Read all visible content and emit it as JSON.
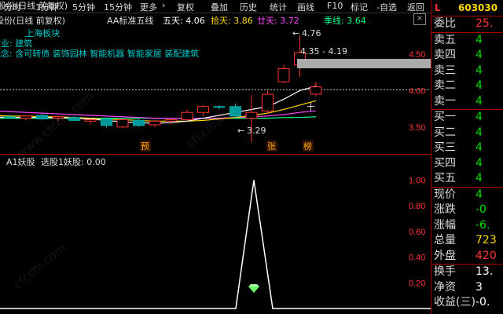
{
  "toolbar": {
    "items": [
      "金筑股份(日线 前复权)",
      "分时",
      "1分钟",
      "5分钟",
      "15分钟",
      "更多",
      "复权",
      "叠加",
      "历史",
      "统计",
      "画线",
      "F10",
      "标记",
      "-自选",
      "返回"
    ],
    "more_arrow": "›"
  },
  "infobar": {
    "title": "金筑股份(日线 前复权)",
    "indicator": "AA标准五线",
    "ma5": "五天: 4.06",
    "ma10": "拾天: 3.86",
    "ma20": "廿天: 3.72",
    "ma60": "季线: 3.64",
    "close": "×",
    "colors": {
      "ma5": "#ffffff",
      "ma10": "#ffd700",
      "ma20": "#ff44ff",
      "ma60": "#00ff88"
    }
  },
  "notes": {
    "line1": "上海板块",
    "line2": "行业: 建筑",
    "line3": "概念: 含可转债 装饰园林 智能机器 智能家居 装配建筑"
  },
  "main_chart": {
    "y_axis": [
      "4.50",
      "4.00",
      "3.50"
    ],
    "hi_label": "4.76",
    "range_label": "4.35 - 4.19",
    "lo_label": "3.29",
    "markers": [
      "预",
      "张",
      "榜"
    ],
    "crosshair_glyph": "十"
  },
  "indicator": {
    "title": "A1妖股",
    "subtitle": "选股1妖股: 0.00",
    "y_axis": [
      "1.00",
      "0.80",
      "0.60",
      "0.40",
      "0.20"
    ]
  },
  "chart_data": {
    "type": "bar",
    "title": "金筑股份(日线 前复权)",
    "candles": [
      {
        "o": 3.65,
        "h": 3.68,
        "l": 3.6,
        "c": 3.62
      },
      {
        "o": 3.64,
        "h": 3.67,
        "l": 3.61,
        "c": 3.63
      },
      {
        "o": 3.62,
        "h": 3.66,
        "l": 3.59,
        "c": 3.65
      },
      {
        "o": 3.66,
        "h": 3.68,
        "l": 3.6,
        "c": 3.61
      },
      {
        "o": 3.62,
        "h": 3.66,
        "l": 3.58,
        "c": 3.64
      },
      {
        "o": 3.63,
        "h": 3.65,
        "l": 3.58,
        "c": 3.59
      },
      {
        "o": 3.58,
        "h": 3.62,
        "l": 3.54,
        "c": 3.6
      },
      {
        "o": 3.61,
        "h": 3.63,
        "l": 3.49,
        "c": 3.52
      },
      {
        "o": 3.5,
        "h": 3.62,
        "l": 3.48,
        "c": 3.6
      },
      {
        "o": 3.59,
        "h": 3.61,
        "l": 3.5,
        "c": 3.52
      },
      {
        "o": 3.53,
        "h": 3.6,
        "l": 3.5,
        "c": 3.58
      },
      {
        "o": 3.58,
        "h": 3.62,
        "l": 3.54,
        "c": 3.6
      },
      {
        "o": 3.6,
        "h": 3.74,
        "l": 3.58,
        "c": 3.7
      },
      {
        "o": 3.7,
        "h": 3.8,
        "l": 3.65,
        "c": 3.78
      },
      {
        "o": 3.78,
        "h": 3.8,
        "l": 3.74,
        "c": 3.77
      },
      {
        "o": 3.78,
        "h": 3.82,
        "l": 3.62,
        "c": 3.65
      },
      {
        "o": 3.62,
        "h": 3.94,
        "l": 3.29,
        "c": 3.7
      },
      {
        "o": 3.72,
        "h": 4.0,
        "l": 3.68,
        "c": 3.95
      },
      {
        "o": 4.12,
        "h": 4.35,
        "l": 4.1,
        "c": 4.3
      },
      {
        "o": 4.35,
        "h": 4.76,
        "l": 4.19,
        "c": 4.52
      },
      {
        "o": 3.95,
        "h": 4.12,
        "l": 3.92,
        "c": 4.05
      }
    ],
    "ma": {
      "five_day": [
        3.64,
        3.63,
        3.63,
        3.63,
        3.63,
        3.62,
        3.61,
        3.59,
        3.57,
        3.56,
        3.55,
        3.56,
        3.58,
        3.62,
        3.66,
        3.7,
        3.74,
        3.78,
        3.88,
        4.0,
        4.06
      ],
      "ten_day": [
        3.66,
        3.65,
        3.65,
        3.64,
        3.64,
        3.63,
        3.62,
        3.61,
        3.6,
        3.59,
        3.58,
        3.58,
        3.58,
        3.59,
        3.61,
        3.63,
        3.66,
        3.69,
        3.74,
        3.8,
        3.86
      ],
      "twenty_day": [
        3.72,
        3.71,
        3.7,
        3.69,
        3.68,
        3.67,
        3.66,
        3.65,
        3.64,
        3.63,
        3.62,
        3.62,
        3.62,
        3.62,
        3.62,
        3.63,
        3.64,
        3.65,
        3.67,
        3.7,
        3.72
      ],
      "sixty_day": [
        3.62,
        3.62,
        3.62,
        3.62,
        3.62,
        3.62,
        3.62,
        3.62,
        3.62,
        3.62,
        3.62,
        3.62,
        3.62,
        3.62,
        3.62,
        3.62,
        3.62,
        3.62,
        3.63,
        3.63,
        3.64
      ]
    },
    "prev_close": 4.0,
    "ylim": [
      3.25,
      4.8
    ],
    "indicator_series": {
      "name": "A1妖股",
      "ylim": [
        0,
        1.1
      ],
      "values": [
        0,
        0,
        0,
        0,
        0,
        0,
        0,
        0,
        0,
        0,
        0,
        0,
        0,
        0,
        0,
        0,
        0,
        0,
        1,
        0,
        0
      ]
    }
  },
  "right_panel": {
    "code": "603030",
    "L": "L",
    "rows": [
      {
        "label": "委比",
        "value": "25."
      },
      {
        "label": "卖五",
        "value": "4"
      },
      {
        "label": "卖四",
        "value": "4"
      },
      {
        "label": "卖三",
        "value": "4"
      },
      {
        "label": "卖二",
        "value": "4"
      },
      {
        "label": "卖一",
        "value": "4"
      },
      {
        "label": "买一",
        "value": "4"
      },
      {
        "label": "买二",
        "value": "4"
      },
      {
        "label": "买三",
        "value": "4"
      },
      {
        "label": "买四",
        "value": "4"
      },
      {
        "label": "买五",
        "value": "4"
      },
      {
        "label": "现价",
        "value": "4"
      },
      {
        "label": "涨跌",
        "value": "-0"
      },
      {
        "label": "涨幅",
        "value": "-6."
      },
      {
        "label": "总量",
        "value": "723"
      },
      {
        "label": "外盘",
        "value": "420"
      },
      {
        "label": "换手",
        "value": "13."
      },
      {
        "label": "净资",
        "value": "3"
      },
      {
        "label": "收益(三)",
        "value": "-0."
      }
    ]
  },
  "watermarks": [
    "www.cfcchi.com",
    "cfcchi.com",
    "cfcchi.com"
  ]
}
